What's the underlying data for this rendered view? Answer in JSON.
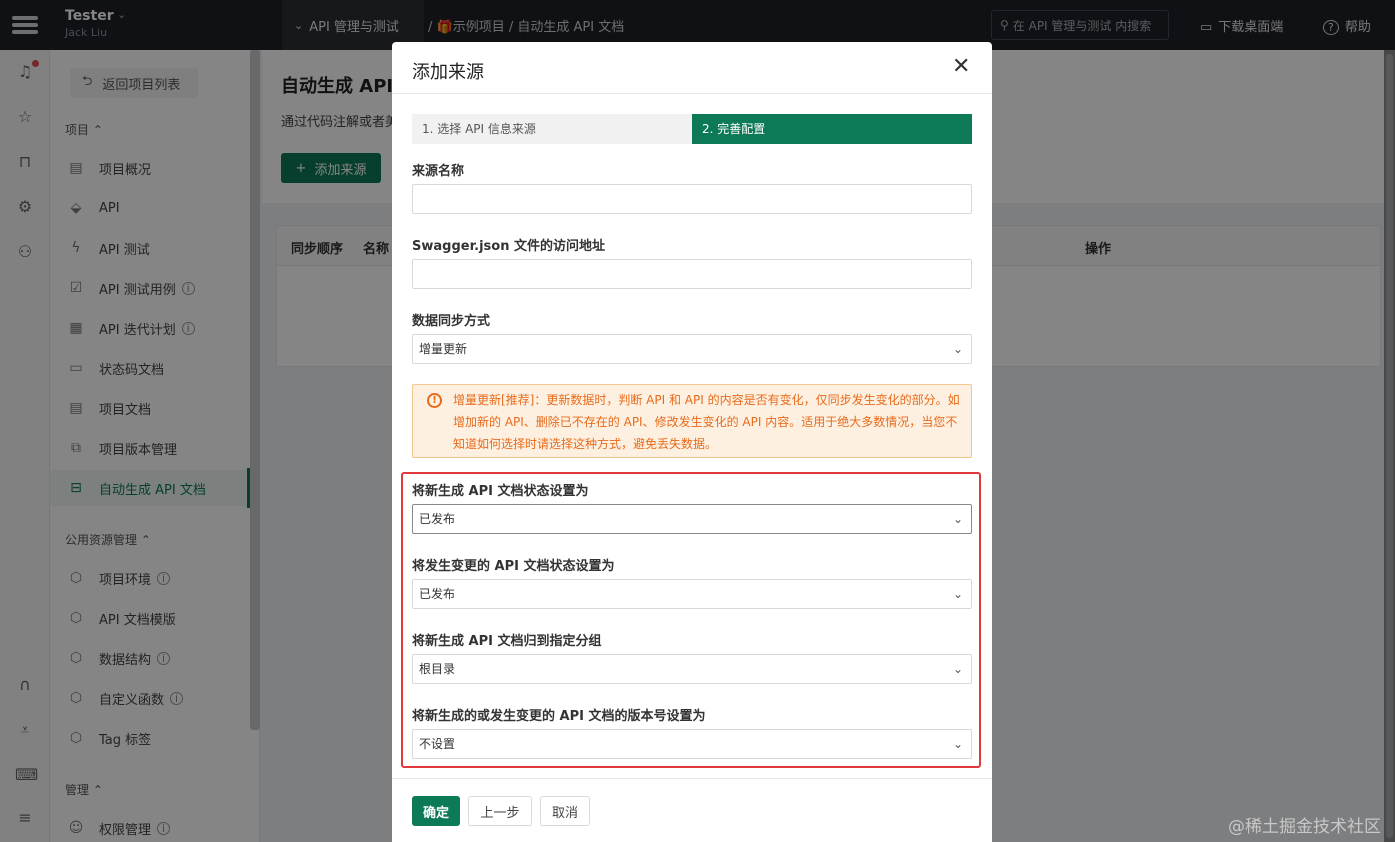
{
  "topbar": {
    "user_name": "Tester",
    "user_sub": "Jack Liu",
    "project_selector": "API 管理与测试",
    "breadcrumb_project": "示例项目",
    "breadcrumb_page": "自动生成 API 文档",
    "search_placeholder": "在 API 管理与测试 内搜索",
    "download_label": "下载桌面端",
    "help_label": "帮助"
  },
  "nav": {
    "back_label": "返回项目列表",
    "section_project": "项目",
    "project_items": [
      {
        "label": "项目概况",
        "icon": "dashboard-icon"
      },
      {
        "label": "API",
        "icon": "api-icon"
      },
      {
        "label": "API 测试",
        "icon": "bolt-icon"
      },
      {
        "label": "API 测试用例",
        "icon": "checklist-icon"
      },
      {
        "label": "API 迭代计划",
        "icon": "calendar-icon"
      },
      {
        "label": "状态码文档",
        "icon": "status-doc-icon"
      },
      {
        "label": "项目文档",
        "icon": "document-icon"
      },
      {
        "label": "项目版本管理",
        "icon": "versions-icon"
      },
      {
        "label": "自动生成 API 文档",
        "icon": "robot-icon"
      }
    ],
    "section_public": "公用资源管理",
    "public_items": [
      {
        "label": "项目环境",
        "icon": "cube-icon"
      },
      {
        "label": "API 文档模版",
        "icon": "cube-icon"
      },
      {
        "label": "数据结构",
        "icon": "cube-icon"
      },
      {
        "label": "自定义函数",
        "icon": "cube-icon"
      },
      {
        "label": "Tag 标签",
        "icon": "cube-icon"
      }
    ],
    "section_manage": "管理",
    "manage_items": [
      {
        "label": "权限管理",
        "icon": "user-icon"
      }
    ]
  },
  "page": {
    "title": "自动生成 API",
    "desc": "通过代码注解或者美",
    "add_button": "添加来源",
    "columns": [
      "同步顺序",
      "名称",
      "操作"
    ]
  },
  "modal": {
    "title": "添加来源",
    "step1": "1. 选择 API 信息来源",
    "step2": "2. 完善配置",
    "source_name_label": "来源名称",
    "source_name_value": "",
    "swagger_label": "Swagger.json 文件的访问地址",
    "swagger_value": "",
    "sync_label": "数据同步方式",
    "sync_value": "增量更新",
    "warning_line1": "增量更新[推荐]：更新数据时，判断 API 和 API 的内容是否有变化，仅同步发生变化的部分。如",
    "warning_line2": "增加新的 API、删除已不存在的 API、修改发生变化的 API 内容。适用于绝大多数情况，当您不",
    "warning_line3": "知道如何选择时请选择这种方式，避免丢失数据。",
    "new_status_label": "将新生成 API 文档状态设置为",
    "new_status_value": "已发布",
    "changed_status_label": "将发生变更的 API 文档状态设置为",
    "changed_status_value": "已发布",
    "group_label": "将新生成 API 文档归到指定分组",
    "group_value": "根目录",
    "version_label": "将新生成的或发生变更的 API 文档的版本号设置为",
    "version_value": "不设置",
    "confirm_button": "确定",
    "prev_button": "上一步",
    "cancel_button": "取消"
  },
  "watermark": "@稀土掘金技术社区",
  "colors": {
    "brand": "#0d7a57",
    "warning": "#e86b1c",
    "highlight": "#e03a3a"
  }
}
